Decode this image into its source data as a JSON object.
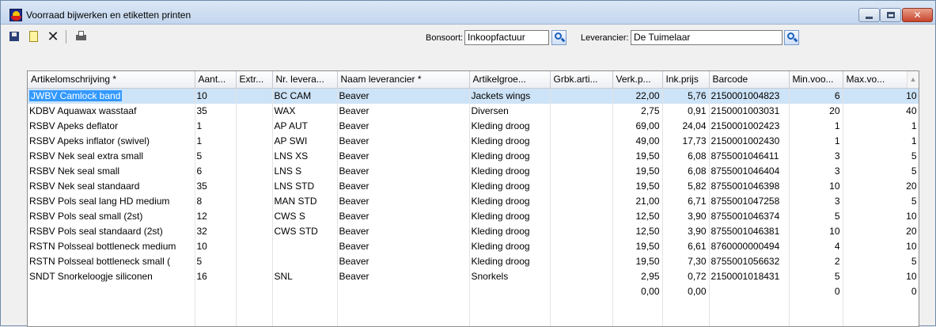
{
  "window": {
    "title": "Voorraad bijwerken en etiketten printen"
  },
  "icons": {
    "app": "app-logo-icon",
    "save": "save-icon",
    "new": "new-document-icon",
    "delete": "delete-icon",
    "print": "print-icon",
    "lookup": "search-lookup-icon"
  },
  "filters": {
    "bonsoort_label": "Bonsoort:",
    "bonsoort_value": "Inkoopfactuur",
    "leverancier_label": "Leverancier:",
    "leverancier_value": "De Tuimelaar"
  },
  "table": {
    "columns": [
      "Artikelomschrijving *",
      "Aant...",
      "Extr...",
      "Nr. levera...",
      "Naam leverancier *",
      "Artikelgroe...",
      "Grbk.arti...",
      "Verk.p...",
      "Ink.prijs",
      "Barcode",
      "Min.voo...",
      "Max.vo..."
    ],
    "rows": [
      [
        "JWBV Camlock band",
        "10",
        "",
        "BC CAM",
        "Beaver",
        "Jackets wings",
        "",
        "22,00",
        "5,76",
        "2150001004823",
        "6",
        "10"
      ],
      [
        "KDBV Aquawax wasstaaf",
        "35",
        "",
        "WAX",
        "Beaver",
        "Diversen",
        "",
        "2,75",
        "0,91",
        "2150001003031",
        "20",
        "40"
      ],
      [
        "RSBV Apeks deflator",
        "1",
        "",
        "AP AUT",
        "Beaver",
        "Kleding droog",
        "",
        "69,00",
        "24,04",
        "2150001002423",
        "1",
        "1"
      ],
      [
        "RSBV Apeks inflator (swivel)",
        "1",
        "",
        "AP SWI",
        "Beaver",
        "Kleding droog",
        "",
        "49,00",
        "17,73",
        "2150001002430",
        "1",
        "1"
      ],
      [
        "RSBV Nek seal extra small",
        "5",
        "",
        "LNS XS",
        "Beaver",
        "Kleding droog",
        "",
        "19,50",
        "6,08",
        "8755001046411",
        "3",
        "5"
      ],
      [
        "RSBV Nek seal small",
        "6",
        "",
        "LNS S",
        "Beaver",
        "Kleding droog",
        "",
        "19,50",
        "6,08",
        "8755001046404",
        "3",
        "5"
      ],
      [
        "RSBV Nek seal standaard",
        "35",
        "",
        "LNS STD",
        "Beaver",
        "Kleding droog",
        "",
        "19,50",
        "5,82",
        "8755001046398",
        "10",
        "20"
      ],
      [
        "RSBV Pols seal lang HD medium",
        "8",
        "",
        "MAN STD",
        "Beaver",
        "Kleding droog",
        "",
        "21,00",
        "6,71",
        "8755001047258",
        "3",
        "5"
      ],
      [
        "RSBV Pols seal small (2st)",
        "12",
        "",
        "CWS S",
        "Beaver",
        "Kleding droog",
        "",
        "12,50",
        "3,90",
        "8755001046374",
        "5",
        "10"
      ],
      [
        "RSBV Pols seal standaard (2st)",
        "32",
        "",
        "CWS STD",
        "Beaver",
        "Kleding droog",
        "",
        "12,50",
        "3,90",
        "8755001046381",
        "10",
        "20"
      ],
      [
        "RSTN Polsseal bottleneck medium",
        "10",
        "",
        "",
        "Beaver",
        "Kleding droog",
        "",
        "19,50",
        "6,61",
        "8760000000494",
        "4",
        "10"
      ],
      [
        "RSTN Polsseal bottleneck small (",
        "5",
        "",
        "",
        "Beaver",
        "Kleding droog",
        "",
        "19,50",
        "7,30",
        "8755001056632",
        "2",
        "5"
      ],
      [
        "SNDT Snorkeloogje siliconen",
        "16",
        "",
        "SNL",
        "Beaver",
        "Snorkels",
        "",
        "2,95",
        "0,72",
        "2150001018431",
        "5",
        "10"
      ],
      [
        "",
        "",
        "",
        "",
        "",
        "",
        "",
        "0,00",
        "0,00",
        "",
        "0",
        "0"
      ],
      [
        "",
        "",
        "",
        "",
        "",
        "",
        "",
        "",
        "",
        "",
        "",
        ""
      ],
      [
        "",
        "",
        "",
        "",
        "",
        "",
        "",
        "",
        "",
        "",
        "",
        ""
      ]
    ],
    "selected_row": 0
  }
}
